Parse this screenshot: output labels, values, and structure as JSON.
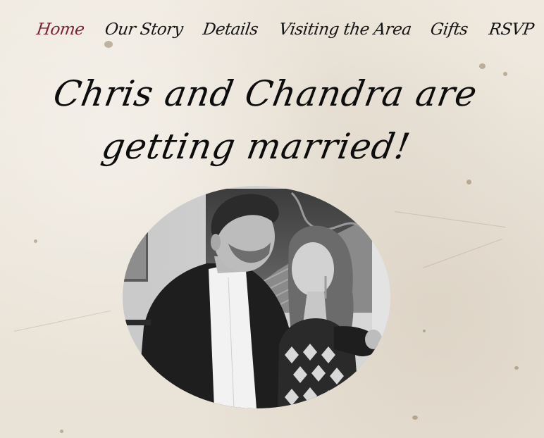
{
  "nav": {
    "items": [
      {
        "label": "Home",
        "active": true
      },
      {
        "label": "Our Story",
        "active": false
      },
      {
        "label": "Details",
        "active": false
      },
      {
        "label": "Visiting the Area",
        "active": false
      },
      {
        "label": "Gifts",
        "active": false
      },
      {
        "label": "RSVP",
        "active": false
      }
    ]
  },
  "hero": {
    "title_line1": "Chris and Chandra are",
    "title_line2": "getting married!"
  },
  "colors": {
    "background": "#ece6dc",
    "text": "#141414",
    "active_nav": "#7a2436"
  }
}
